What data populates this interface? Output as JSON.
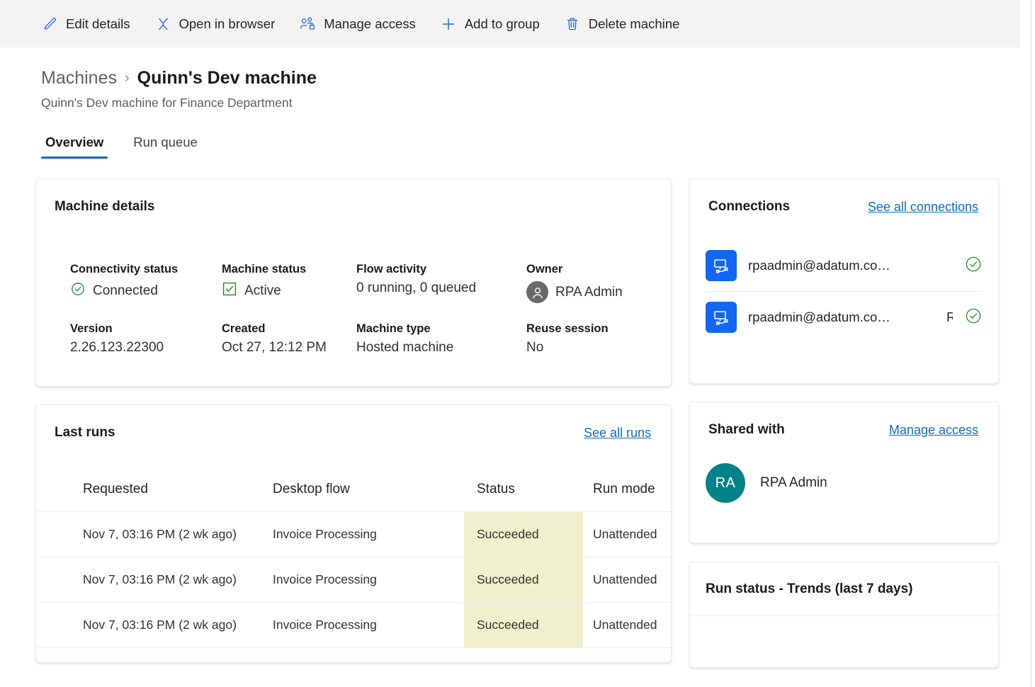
{
  "commandbar": {
    "items": [
      {
        "label": "Edit details",
        "icon": "pencil-icon"
      },
      {
        "label": "Open in browser",
        "icon": "open-in-browser-icon"
      },
      {
        "label": "Manage access",
        "icon": "manage-access-icon"
      },
      {
        "label": "Add to group",
        "icon": "plus-icon"
      },
      {
        "label": "Delete machine",
        "icon": "trash-icon"
      }
    ]
  },
  "header": {
    "breadcrumb_parent": "Machines",
    "breadcrumb_separator": "›",
    "breadcrumb_current": "Quinn's Dev machine",
    "subtitle": "Quinn's Dev machine for Finance Department"
  },
  "tabs": [
    {
      "label": "Overview",
      "active": true
    },
    {
      "label": "Run queue",
      "active": false
    }
  ],
  "machine_details": {
    "title": "Machine details",
    "fields": [
      {
        "label": "Connectivity status",
        "value": "Connected",
        "icon": "check-circle-icon"
      },
      {
        "label": "Machine status",
        "value": "Active",
        "icon": "check-square-icon"
      },
      {
        "label": "Flow activity",
        "value": "0 running, 0 queued",
        "icon": ""
      },
      {
        "label": "Owner",
        "value": "RPA Admin",
        "icon": "person-avatar-icon"
      },
      {
        "label": "Version",
        "value": "2.26.123.22300",
        "icon": ""
      },
      {
        "label": "Created",
        "value": "Oct 27, 12:12 PM",
        "icon": ""
      },
      {
        "label": "Machine type",
        "value": "Hosted machine",
        "icon": ""
      },
      {
        "label": "Reuse session",
        "value": "No",
        "icon": ""
      }
    ]
  },
  "last_runs": {
    "title": "Last runs",
    "link": "See all runs",
    "columns": [
      "Requested",
      "Desktop flow",
      "Status",
      "Run mode"
    ],
    "rows": [
      {
        "requested": "Nov 7, 03:16 PM (2 wk ago)",
        "flow": "Invoice Processing",
        "status": "Succeeded",
        "mode": "Unattended"
      },
      {
        "requested": "Nov 7, 03:16 PM (2 wk ago)",
        "flow": "Invoice Processing",
        "status": "Succeeded",
        "mode": "Unattended"
      },
      {
        "requested": "Nov 7, 03:16 PM (2 wk ago)",
        "flow": "Invoice Processing",
        "status": "Succeeded",
        "mode": "Unattended"
      }
    ]
  },
  "connections": {
    "title": "Connections",
    "link": "See all connections",
    "rows": [
      {
        "name": "rpaadmin@adatum.co…",
        "extra": "",
        "status_icon": "check-circle-icon"
      },
      {
        "name": "rpaadmin@adatum.co…",
        "extra": "R",
        "status_icon": "check-circle-icon"
      }
    ]
  },
  "shared_with": {
    "title": "Shared with",
    "link": "Manage access",
    "people": [
      {
        "initials": "RA",
        "name": "RPA Admin"
      }
    ]
  },
  "run_trends": {
    "title": "Run status - Trends (last 7 days)"
  },
  "colors": {
    "accent": "#0f6cbd",
    "link": "#0f6cbd",
    "success_green": "#107c10",
    "status_cell_bg": "#eff0cc",
    "avatar_teal": "#038387",
    "connection_tile_blue": "#1266f1",
    "commandbar_bg": "#f3f3f3"
  }
}
